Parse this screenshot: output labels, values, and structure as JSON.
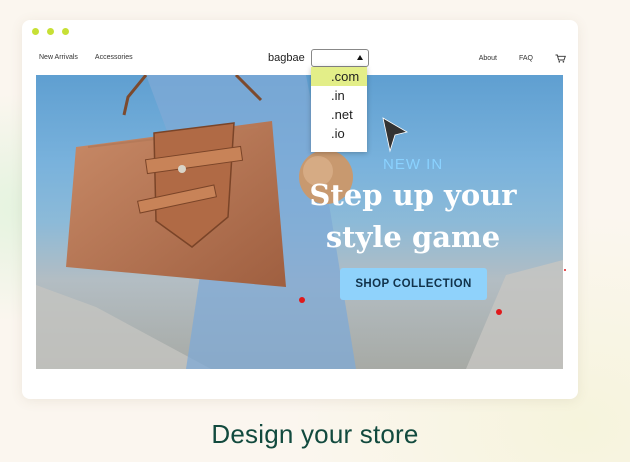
{
  "store": {
    "brand": "bagbae"
  },
  "nav": {
    "left": [
      "New Arrivals",
      "Accessories"
    ],
    "right": [
      "About",
      "FAQ"
    ]
  },
  "domain_select": {
    "current": "",
    "options": [
      ".com",
      ".in",
      ".net",
      ".io"
    ],
    "highlighted": ".com"
  },
  "hero": {
    "kicker": "NEW IN",
    "title": "Step up your\nstyle game",
    "cta": "SHOP COLLECTION"
  },
  "tagline": "Design your store",
  "icons": {
    "cart": "cart-icon",
    "cursor": "pointer-cursor-icon",
    "window_controls": "window-dot-icon"
  },
  "colors": {
    "window_dots": "#c7e035",
    "highlight": "#e3ee88",
    "cta_bg": "#8fd2fb",
    "kicker": "#8ad2ff",
    "tagline": "#124a3e",
    "marker": "#e0191b"
  }
}
